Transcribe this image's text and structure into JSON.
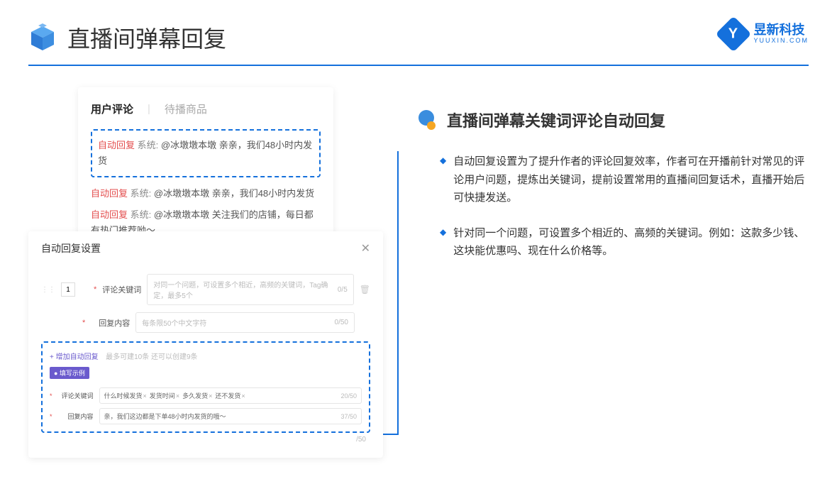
{
  "header": {
    "title": "直播间弹幕回复",
    "brand_name": "昱新科技",
    "brand_sub": "YUUXIN.COM",
    "brand_letter": "Y"
  },
  "comments": {
    "tab_active": "用户评论",
    "tab_inactive": "待播商品",
    "tag": "自动回复",
    "sys_prefix": "系统:",
    "highlighted": "@冰墩墩本墩 亲亲，我们48小时内发货",
    "line2": "@冰墩墩本墩 亲亲，我们48小时内发货",
    "line3": "@冰墩墩本墩 关注我们的店铺，每日都有热门推荐呦～"
  },
  "settings": {
    "title": "自动回复设置",
    "num": "1",
    "label_keyword": "评论关键词",
    "placeholder_keyword": "对同一个问题，可设置多个相近，高频的关键词，Tag确定，最多5个",
    "counter_keyword": "0/5",
    "label_content": "回复内容",
    "placeholder_content": "每条限50个中文字符",
    "counter_content": "0/50",
    "add_link": "+ 增加自动回复",
    "add_hint": "最多可建10条 还可以创建9条",
    "example_tag": "● 填写示例",
    "ex_label_keyword": "评论关键词",
    "ex_chips": [
      "什么时候发货",
      "发货时间",
      "多久发货",
      "还不发货"
    ],
    "ex_counter_keyword": "20/50",
    "ex_label_content": "回复内容",
    "ex_content": "亲，我们这边都是下单48小时内发货的哦～",
    "ex_counter_content": "37/50",
    "outer_counter": "/50"
  },
  "right": {
    "section_title": "直播间弹幕关键词评论自动回复",
    "bullet1": "自动回复设置为了提升作者的评论回复效率，作者可在开播前针对常见的评论用户问题，提炼出关键词，提前设置常用的直播间回复话术，直播开始后可快捷发送。",
    "bullet2": "针对同一个问题，可设置多个相近的、高频的关键词。例如：这款多少钱、这块能优惠吗、现在什么价格等。"
  }
}
